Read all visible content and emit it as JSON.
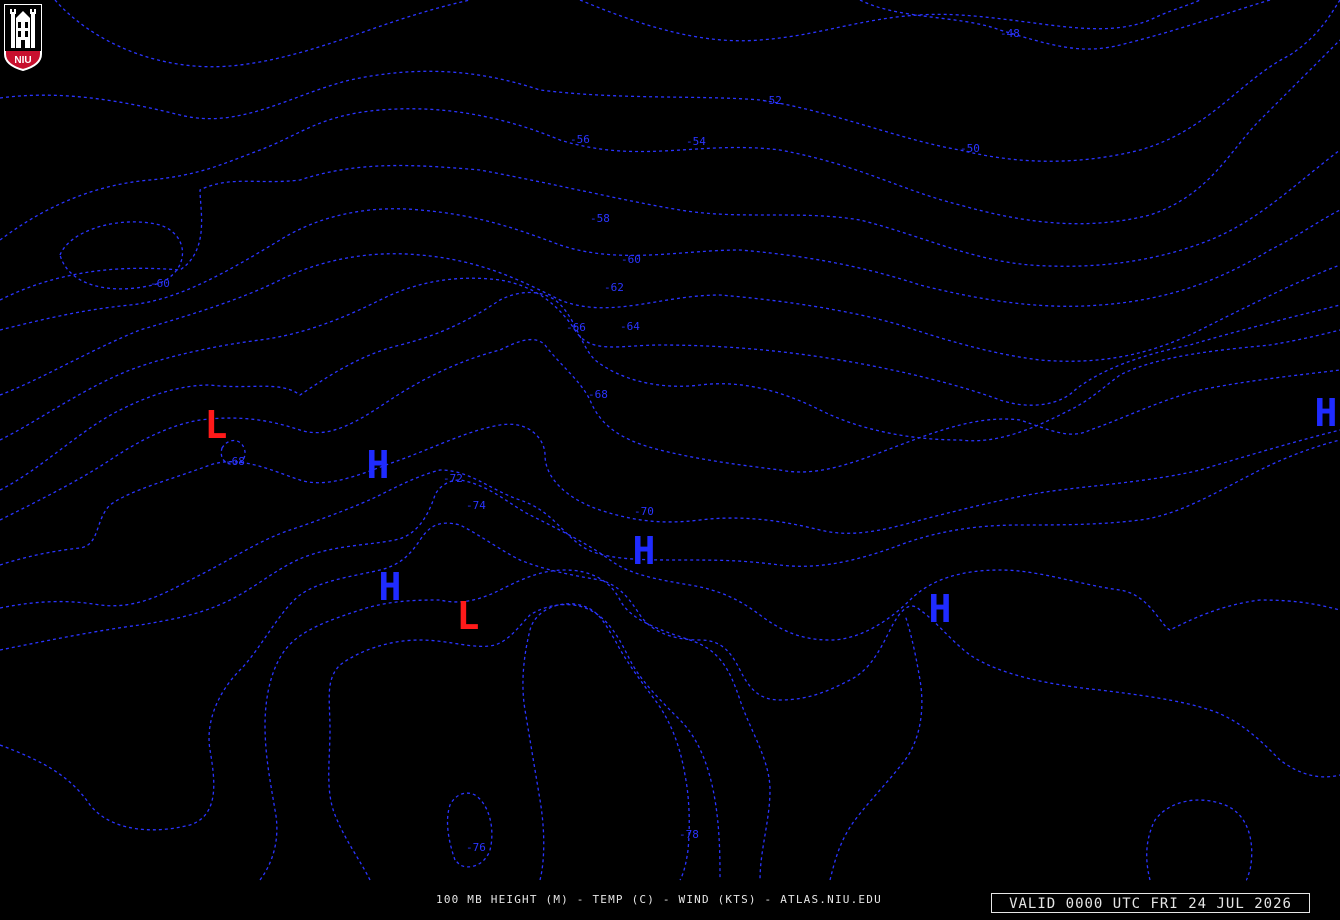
{
  "logo": {
    "text": "NIU",
    "colors": {
      "red": "#c8102e",
      "white": "#ffffff",
      "black": "#000000"
    }
  },
  "contour_color": "#2a34ff",
  "contour_labels": [
    "-48",
    "-52",
    "-50",
    "-56",
    "-54",
    "-58",
    "-60",
    "-60",
    "-62",
    "-66",
    "-64",
    "-68",
    "-68",
    "-72",
    "-74",
    "-70",
    "-78",
    "-76"
  ],
  "pressure_centers": [
    {
      "label": "L",
      "type": "low",
      "color": "#ff1a1a"
    },
    {
      "label": "H",
      "type": "high",
      "color": "#1f2bff"
    },
    {
      "label": "H",
      "type": "high",
      "color": "#1f2bff"
    },
    {
      "label": "L",
      "type": "low",
      "color": "#ff1a1a"
    },
    {
      "label": "H",
      "type": "high",
      "color": "#1f2bff"
    },
    {
      "label": "H",
      "type": "high",
      "color": "#1f2bff"
    },
    {
      "label": "H",
      "type": "high",
      "color": "#1f2bff"
    }
  ],
  "footer": {
    "caption": "100 MB HEIGHT (M) - TEMP (C) - WIND (KTS) - ATLAS.NIU.EDU",
    "valid": "VALID 0000 UTC FRI 24 JUL 2026"
  }
}
